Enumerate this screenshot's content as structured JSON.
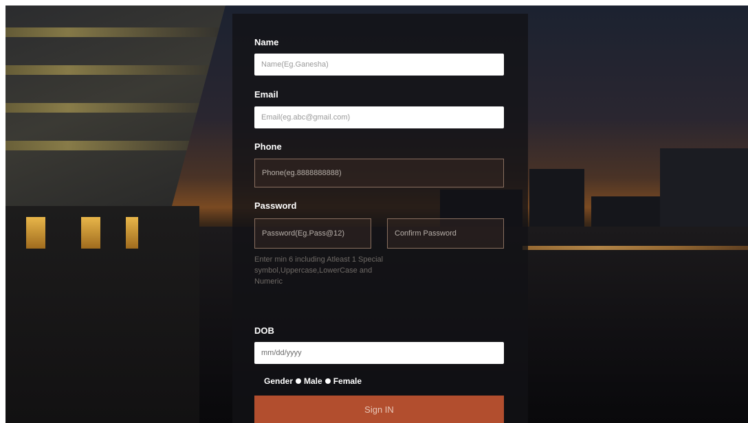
{
  "form": {
    "name_label": "Name",
    "name_placeholder": "Name(Eg.Ganesha)",
    "email_label": "Email",
    "email_placeholder": "Email(eg.abc@gmail.com)",
    "phone_label": "Phone",
    "phone_placeholder": "Phone(eg.8888888888)",
    "password_label": "Password",
    "password_placeholder": "Password(Eg.Pass@12)",
    "confirm_password_placeholder": "Confirm Password",
    "password_hint": "Enter min 6 including Atleast 1 Special symbol,Uppercase,LowerCase and Numeric",
    "dob_label": "DOB",
    "dob_placeholder": "mm/dd/yyyy",
    "gender_label": "Gender",
    "gender_options": [
      "Male",
      "Female"
    ],
    "submit_label": "Sign IN"
  },
  "colors": {
    "accent": "#b24e2e",
    "card_bg": "#121216",
    "input_bg": "#ffffff"
  }
}
